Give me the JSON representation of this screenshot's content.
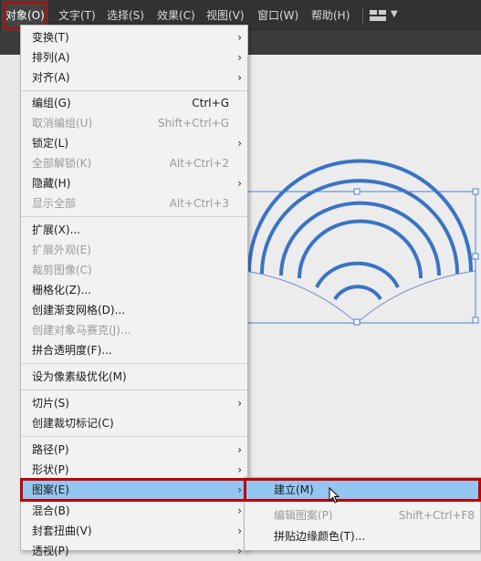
{
  "menubar": {
    "items": [
      "对象(O)",
      "文字(T)",
      "选择(S)",
      "效果(C)",
      "视图(V)",
      "窗口(W)",
      "帮助(H)"
    ],
    "active": "对象(O)",
    "workspace_icon": "workspace-layout-icon"
  },
  "menu": {
    "items": [
      {
        "label": "变换(T)",
        "shortcut": "",
        "submenu": true,
        "disabled": false
      },
      {
        "label": "排列(A)",
        "shortcut": "",
        "submenu": true,
        "disabled": false
      },
      {
        "label": "对齐(A)",
        "shortcut": "",
        "submenu": true,
        "disabled": false
      },
      {
        "label": "编组(G)",
        "shortcut": "Ctrl+G",
        "submenu": false,
        "disabled": false
      },
      {
        "label": "取消编组(U)",
        "shortcut": "Shift+Ctrl+G",
        "submenu": false,
        "disabled": true
      },
      {
        "label": "锁定(L)",
        "shortcut": "",
        "submenu": true,
        "disabled": false
      },
      {
        "label": "全部解锁(K)",
        "shortcut": "Alt+Ctrl+2",
        "submenu": false,
        "disabled": true
      },
      {
        "label": "隐藏(H)",
        "shortcut": "",
        "submenu": true,
        "disabled": false
      },
      {
        "label": "显示全部",
        "shortcut": "Alt+Ctrl+3",
        "submenu": false,
        "disabled": true
      },
      {
        "label": "扩展(X)...",
        "shortcut": "",
        "submenu": false,
        "disabled": false
      },
      {
        "label": "扩展外观(E)",
        "shortcut": "",
        "submenu": false,
        "disabled": true
      },
      {
        "label": "裁剪图像(C)",
        "shortcut": "",
        "submenu": false,
        "disabled": true
      },
      {
        "label": "栅格化(Z)...",
        "shortcut": "",
        "submenu": false,
        "disabled": false
      },
      {
        "label": "创建渐变网格(D)...",
        "shortcut": "",
        "submenu": false,
        "disabled": false
      },
      {
        "label": "创建对象马赛克(J)...",
        "shortcut": "",
        "submenu": false,
        "disabled": true
      },
      {
        "label": "拼合透明度(F)...",
        "shortcut": "",
        "submenu": false,
        "disabled": false
      },
      {
        "label": "设为像素级优化(M)",
        "shortcut": "",
        "submenu": false,
        "disabled": false
      },
      {
        "label": "切片(S)",
        "shortcut": "",
        "submenu": true,
        "disabled": false
      },
      {
        "label": "创建裁切标记(C)",
        "shortcut": "",
        "submenu": false,
        "disabled": false
      },
      {
        "label": "路径(P)",
        "shortcut": "",
        "submenu": true,
        "disabled": false
      },
      {
        "label": "形状(P)",
        "shortcut": "",
        "submenu": true,
        "disabled": false
      },
      {
        "label": "图案(E)",
        "shortcut": "",
        "submenu": true,
        "disabled": false,
        "highlighted": true
      },
      {
        "label": "混合(B)",
        "shortcut": "",
        "submenu": true,
        "disabled": false
      },
      {
        "label": "封套扭曲(V)",
        "shortcut": "",
        "submenu": true,
        "disabled": false
      },
      {
        "label": "透视(P)",
        "shortcut": "",
        "submenu": true,
        "disabled": false
      }
    ]
  },
  "submenu": {
    "items": [
      {
        "label": "建立(M)",
        "shortcut": "",
        "disabled": false,
        "highlighted": true
      },
      {
        "label": "编辑图案(P)",
        "shortcut": "Shift+Ctrl+F8",
        "disabled": true
      },
      {
        "label": "拼贴边缘颜色(T)...",
        "shortcut": "",
        "disabled": false
      }
    ]
  },
  "colors": {
    "arc_stroke": "#3a73c4",
    "highlight": "#93c6f0",
    "annotation_red": "#c00000"
  }
}
